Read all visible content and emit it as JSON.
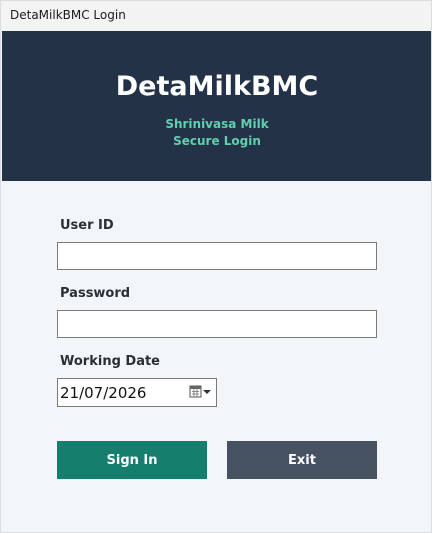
{
  "window": {
    "title": "DetaMilkBMC Login"
  },
  "header": {
    "app_name": "DetaMilkBMC",
    "company": "Shrinivasa Milk",
    "tagline": "Secure Login"
  },
  "form": {
    "user_id": {
      "label": "User ID",
      "value": ""
    },
    "password": {
      "label": "Password",
      "value": ""
    },
    "working_date": {
      "label": "Working Date",
      "value": "21/07/2026"
    }
  },
  "buttons": {
    "sign_in": "Sign In",
    "exit": "Exit"
  },
  "icons": {
    "date_picker": "calendar-dropdown-icon"
  },
  "colors": {
    "header_bg": "#233247",
    "accent_text": "#5fd0ae",
    "sign_in_bg": "#157e6c",
    "exit_bg": "#465162"
  }
}
